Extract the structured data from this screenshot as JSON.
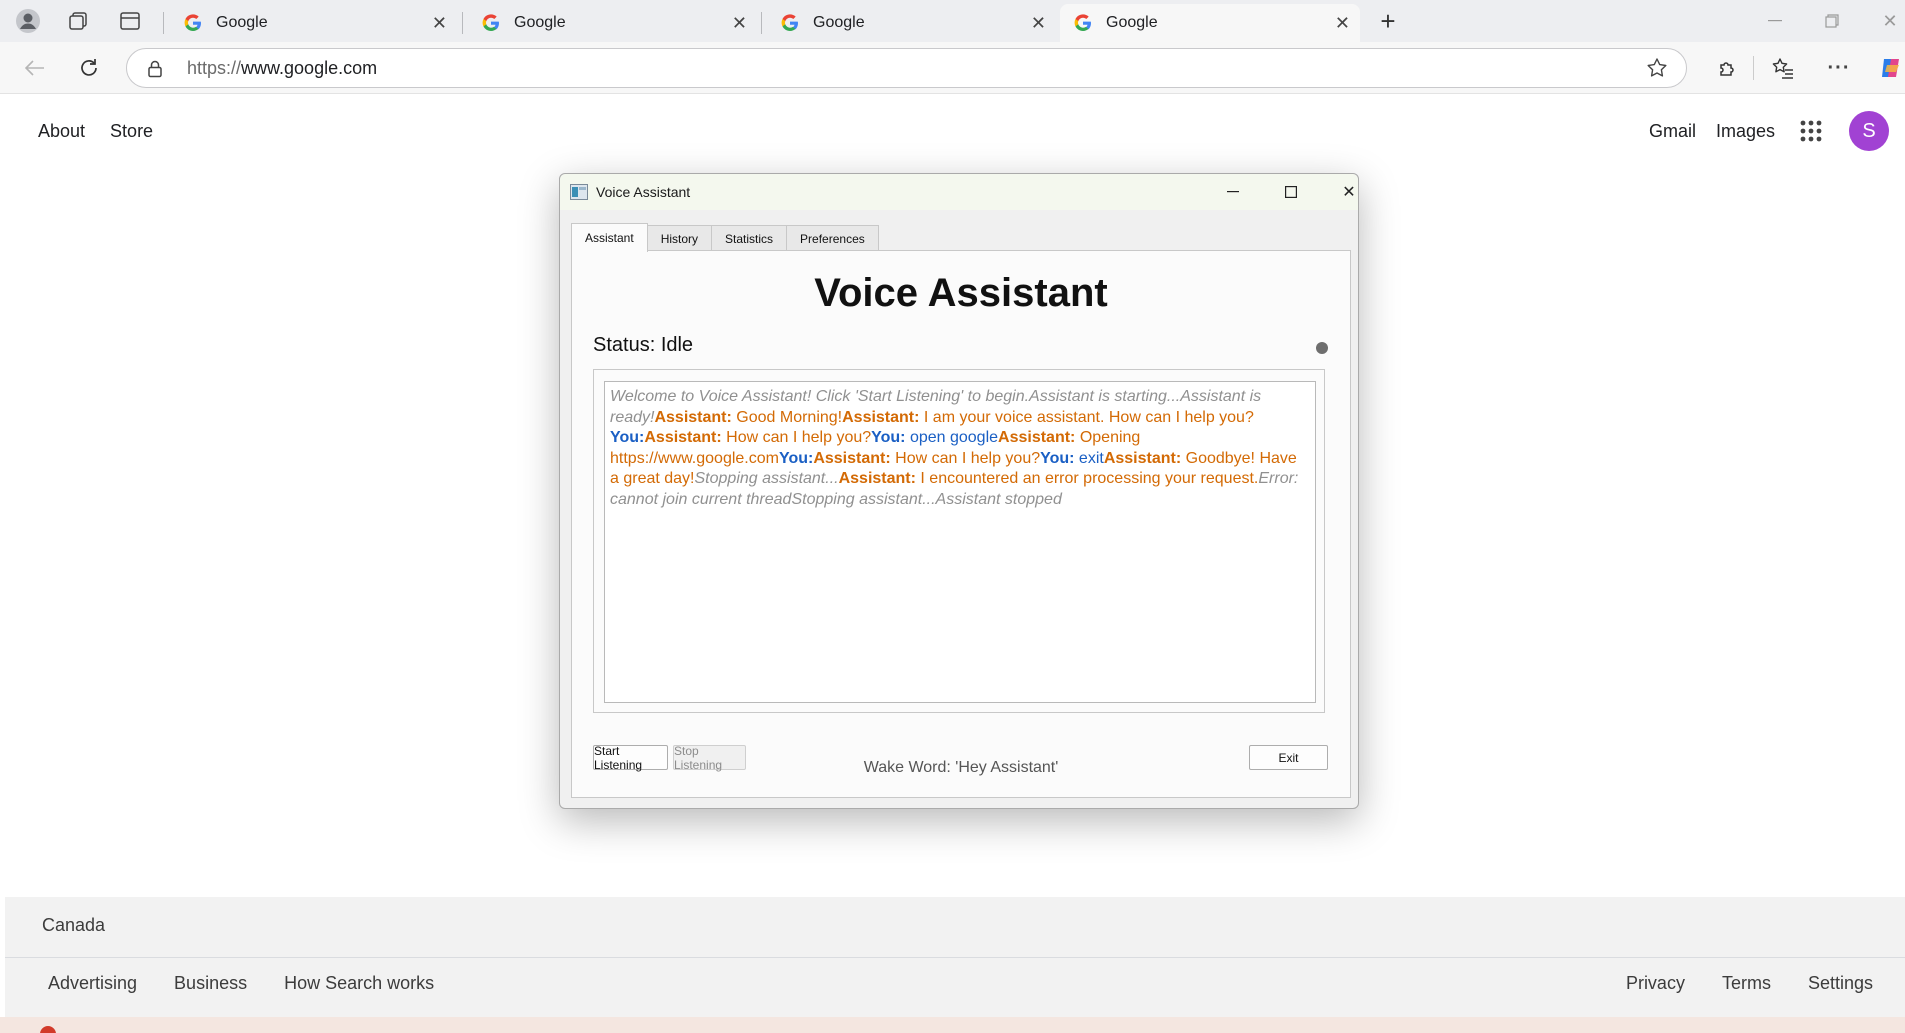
{
  "browser": {
    "tabs": [
      {
        "title": "Google"
      },
      {
        "title": "Google"
      },
      {
        "title": "Google"
      },
      {
        "title": "Google"
      }
    ],
    "url_protocol": "https://",
    "url_host": "www.google.com"
  },
  "google": {
    "left_links": [
      "About",
      "Store"
    ],
    "gmail": "Gmail",
    "images": "Images",
    "avatar_letter": "S",
    "country": "Canada",
    "footer_left": [
      "Advertising",
      "Business",
      "How Search works"
    ],
    "footer_right": [
      "Privacy",
      "Terms",
      "Settings"
    ]
  },
  "dialog": {
    "title": "Voice Assistant",
    "tabs": [
      "Assistant",
      "History",
      "Statistics",
      "Preferences"
    ],
    "heading": "Voice Assistant",
    "status": "Status: Idle",
    "log": [
      {
        "type": "system",
        "text": "Welcome to Voice Assistant! Click 'Start Listening' to begin."
      },
      {
        "type": "system",
        "text": "Assistant is starting..."
      },
      {
        "type": "system",
        "text": "Assistant is ready!"
      },
      {
        "type": "assistant",
        "speaker": "Assistant:",
        "text": " Good Morning!"
      },
      {
        "type": "assistant",
        "speaker": "Assistant:",
        "text": " I am your voice assistant. How can I help you?"
      },
      {
        "type": "user",
        "speaker": "You:",
        "text": ""
      },
      {
        "type": "assistant",
        "speaker": "Assistant:",
        "text": " How can I help you?"
      },
      {
        "type": "user",
        "speaker": "You:",
        "text": " open google"
      },
      {
        "type": "assistant",
        "speaker": "Assistant:",
        "text": " Opening https://www.google.com"
      },
      {
        "type": "user",
        "speaker": "You:",
        "text": ""
      },
      {
        "type": "assistant",
        "speaker": "Assistant:",
        "text": " How can I help you?"
      },
      {
        "type": "user",
        "speaker": "You:",
        "text": " exit"
      },
      {
        "type": "assistant",
        "speaker": "Assistant:",
        "text": " Goodbye! Have a great day!"
      },
      {
        "type": "system",
        "text": "Stopping assistant..."
      },
      {
        "type": "assistant",
        "speaker": "Assistant:",
        "text": " I encountered an error processing your request."
      },
      {
        "type": "system",
        "text": "Error: cannot join current thread"
      },
      {
        "type": "system",
        "text": "Stopping assistant..."
      },
      {
        "type": "system",
        "text": "Assistant stopped"
      }
    ],
    "start_button": "Start Listening",
    "stop_button": "Stop Listening",
    "exit_button": "Exit",
    "wake_word": "Wake Word: 'Hey Assistant'"
  }
}
